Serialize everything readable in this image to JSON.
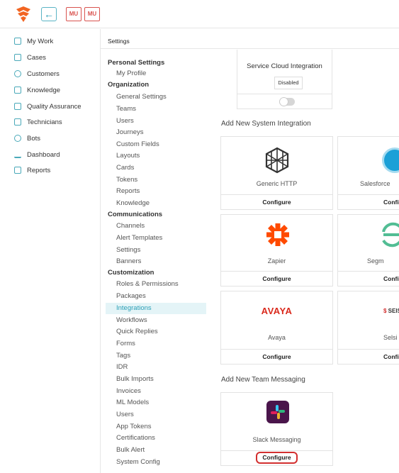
{
  "header": {
    "badges": [
      "MU",
      "MU"
    ],
    "back_icon": "arrow-left-icon",
    "logo_color": "#f26522",
    "accent_color": "#2a9fb6"
  },
  "nav": {
    "items": [
      {
        "label": "My Work",
        "icon": "home-icon"
      },
      {
        "label": "Cases",
        "icon": "briefcase-icon"
      },
      {
        "label": "Customers",
        "icon": "users-icon"
      },
      {
        "label": "Knowledge",
        "icon": "book-icon"
      },
      {
        "label": "Quality Assurance",
        "icon": "checklist-icon"
      },
      {
        "label": "Technicians",
        "icon": "id-card-icon"
      },
      {
        "label": "Bots",
        "icon": "bot-icon"
      },
      {
        "label": "Dashboard",
        "icon": "chart-icon"
      },
      {
        "label": "Reports",
        "icon": "report-icon"
      }
    ]
  },
  "settings": {
    "title": "Settings",
    "menu": {
      "personal": "Personal Settings",
      "my_profile": "My Profile",
      "organization": "Organization",
      "org_items": [
        "General Settings",
        "Teams",
        "Users",
        "Journeys",
        "Custom Fields",
        "Layouts",
        "Cards",
        "Tokens",
        "Reports",
        "Knowledge"
      ],
      "communications": "Communications",
      "comm_items": [
        "Channels",
        "Alert Templates",
        "Settings",
        "Banners"
      ],
      "customization": "Customization",
      "cust_items": [
        "Roles & Permissions",
        "Packages",
        "Integrations",
        "Workflows",
        "Quick Replies",
        "Forms",
        "Tags",
        "IDR",
        "Bulk Imports",
        "Invoices",
        "ML Models",
        "Users",
        "App Tokens",
        "Certifications",
        "Bulk Alert",
        "System Config"
      ]
    }
  },
  "content": {
    "service_cloud": {
      "title": "Service Cloud Integration",
      "status": "Disabled"
    },
    "system_heading": "Add New System Integration",
    "system_cards": [
      {
        "name": "Generic HTTP",
        "action": "Configure"
      },
      {
        "name": "Salesforce",
        "action": "Config"
      },
      {
        "name": "Zapier",
        "action": "Configure"
      },
      {
        "name": "Segm",
        "action": "Config"
      },
      {
        "name": "Avaya",
        "action": "Configure",
        "logo_text": "AVAYA"
      },
      {
        "name": "Selsi",
        "action": "Config",
        "logo_text": "SEIS"
      }
    ],
    "team_heading": "Add New Team Messaging",
    "slack": {
      "name": "Slack Messaging",
      "action": "Configure"
    }
  }
}
